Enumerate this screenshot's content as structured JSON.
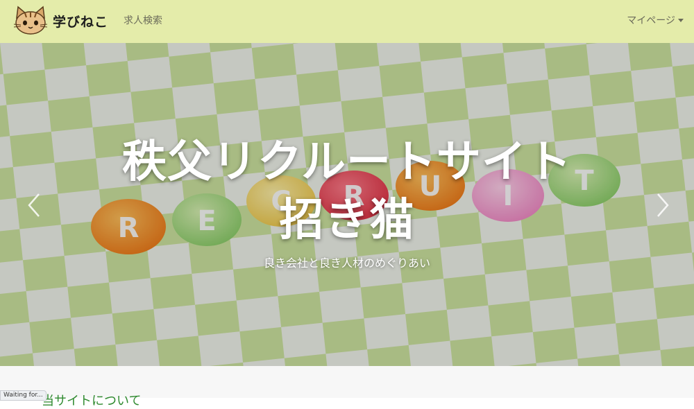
{
  "nav": {
    "brand": "学びねこ",
    "links": [
      "求人検索"
    ],
    "mypage": "マイページ"
  },
  "hero": {
    "title_line1": "秩父リクルートサイト",
    "title_line2": "招き猫",
    "subtitle": "良き会社と良き人材のめぐりあい",
    "chip_letters": [
      "R",
      "E",
      "C",
      "R",
      "U",
      "I",
      "T"
    ]
  },
  "section": {
    "title": "当サイトについて"
  },
  "status": {
    "text": "Waiting for..."
  },
  "colors": {
    "navbar": "#e4ecaa",
    "section_title": "#2f8a2f"
  },
  "icons": [
    "cat-logo-icon",
    "caret-down-icon",
    "chevron-left-icon",
    "chevron-right-icon"
  ]
}
